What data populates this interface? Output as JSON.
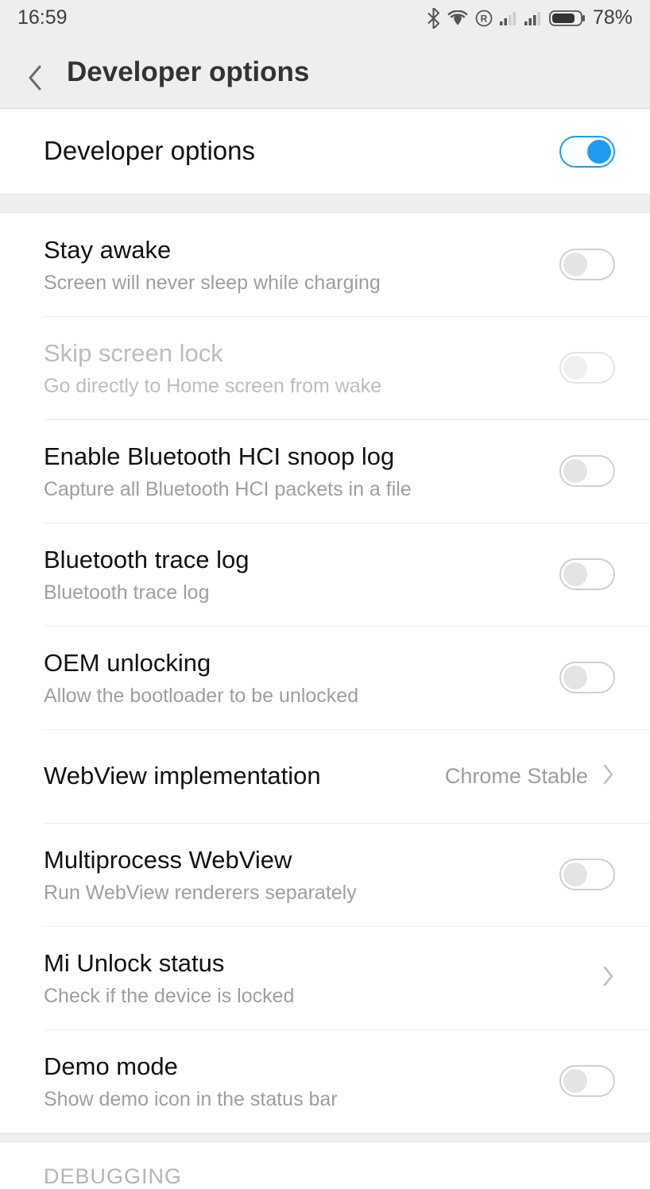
{
  "statusbar": {
    "time": "16:59",
    "battery_pct": "78%"
  },
  "header": {
    "title": "Developer options"
  },
  "primary": {
    "label": "Developer options",
    "on": true
  },
  "settings": [
    {
      "title": "Stay awake",
      "subtitle": "Screen will never sleep while charging",
      "type": "toggle",
      "on": false,
      "disabled": false
    },
    {
      "title": "Skip screen lock",
      "subtitle": "Go directly to Home screen from wake",
      "type": "toggle",
      "on": false,
      "disabled": true
    },
    {
      "title": "Enable Bluetooth HCI snoop log",
      "subtitle": "Capture all Bluetooth HCI packets in a file",
      "type": "toggle",
      "on": false,
      "disabled": false
    },
    {
      "title": "Bluetooth trace log",
      "subtitle": "Bluetooth trace log",
      "type": "toggle",
      "on": false,
      "disabled": false
    },
    {
      "title": "OEM unlocking",
      "subtitle": "Allow the bootloader to be unlocked",
      "type": "toggle",
      "on": false,
      "disabled": false
    },
    {
      "title": "WebView implementation",
      "subtitle": "",
      "type": "link",
      "value": "Chrome Stable",
      "disabled": false
    },
    {
      "title": "Multiprocess WebView",
      "subtitle": "Run WebView renderers separately",
      "type": "toggle",
      "on": false,
      "disabled": false
    },
    {
      "title": "Mi Unlock status",
      "subtitle": "Check if the device is locked",
      "type": "link",
      "value": "",
      "disabled": false
    },
    {
      "title": "Demo mode",
      "subtitle": "Show demo icon in the status bar",
      "type": "toggle",
      "on": false,
      "disabled": false
    }
  ],
  "section_label": "DEBUGGING"
}
